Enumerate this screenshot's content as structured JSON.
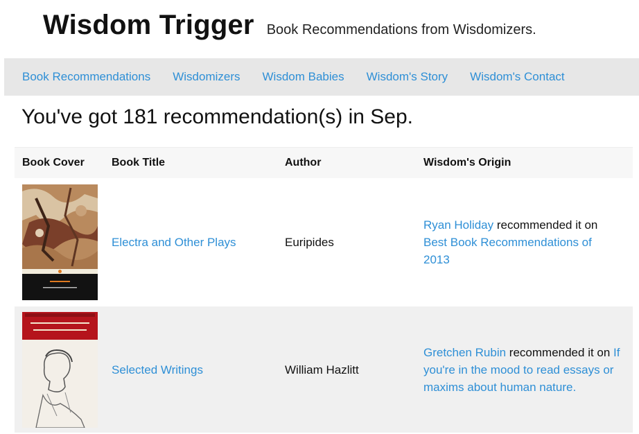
{
  "header": {
    "title": "Wisdom Trigger",
    "subtitle": "Book Recommendations from Wisdomizers."
  },
  "nav": {
    "items": [
      "Book Recommendations",
      "Wisdomizers",
      "Wisdom Babies",
      "Wisdom's Story",
      "Wisdom's Contact"
    ]
  },
  "summary": "You've got 181 recommendation(s) in Sep.",
  "table": {
    "headers": [
      "Book Cover",
      "Book Title",
      "Author",
      "Wisdom's Origin"
    ],
    "rows": [
      {
        "cover_icon": "electra-book-cover",
        "title": "Electra and Other Plays",
        "author": "Euripides",
        "recommender": "Ryan Holiday",
        "connector": " recommended it on ",
        "source": "Best Book Recommendations of 2013"
      },
      {
        "cover_icon": "selected-writings-book-cover",
        "title": "Selected Writings",
        "author": "William Hazlitt",
        "recommender": "Gretchen Rubin",
        "connector": " recommended it on ",
        "source": "If you're in the mood to read essays or maxims about human nature."
      }
    ]
  },
  "colors": {
    "link": "#2e8fd6",
    "navbar_bg": "#e7e7e7",
    "even_row_bg": "#f0f0f0"
  }
}
